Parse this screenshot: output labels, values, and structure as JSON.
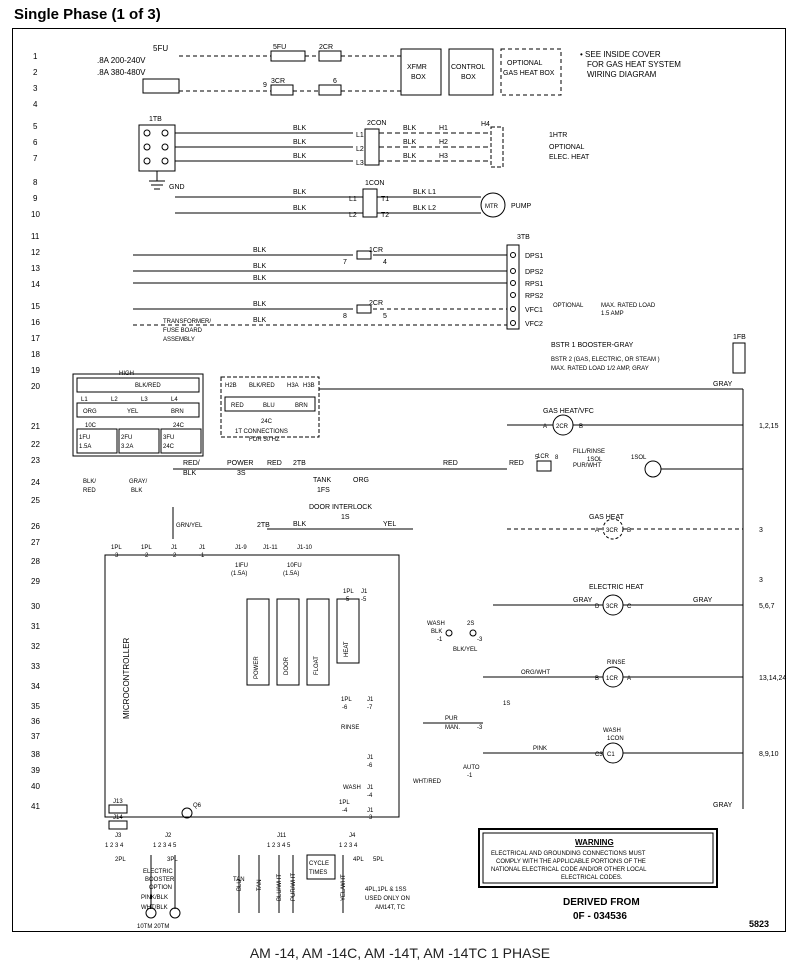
{
  "title": "Single Phase (1 of 3)",
  "caption": "AM -14, AM -14C, AM -14T, AM -14TC 1 PHASE",
  "diagram": {
    "id": "5823",
    "derived_from": "0F - 034536",
    "derived_label": "DERIVED FROM",
    "warning_title": "WARNING",
    "warning_text": "ELECTRICAL AND GROUNDING CONNECTIONS MUST COMPLY WITH THE APPLICABLE PORTIONS OF THE NATIONAL ELECTRICAL CODE AND/OR OTHER LOCAL ELECTRICAL CODES.",
    "note": "SEE INSIDE COVER FOR GAS HEAT SYSTEM WIRING DIAGRAM",
    "row_numbers_left": [
      1,
      2,
      3,
      4,
      5,
      6,
      7,
      8,
      9,
      10,
      11,
      12,
      13,
      14,
      15,
      16,
      17,
      18,
      19,
      20,
      21,
      22,
      23,
      24,
      25,
      26,
      27,
      28,
      29,
      30,
      31,
      32,
      33,
      34,
      35,
      36,
      37,
      38,
      39,
      40,
      41
    ],
    "row_tags_right": {
      "21": "1,2,15",
      "26": "3",
      "29": "3",
      "30": "5,6,7",
      "33": "13,14,24",
      "37": "8,9,10"
    },
    "header": {
      "fu_block": "5FU\n.8A 200-240V\n.8A 380-480V",
      "sec_5fu": "5FU",
      "sec_2cr": "2CR",
      "ref_9": "9",
      "ref_3cr": "3CR",
      "ref_6": "6",
      "xfmr": "XFMR\nBOX",
      "control": "CONTROL\nBOX",
      "optional_gas": "OPTIONAL\nGAS HEAT BOX"
    },
    "tb": {
      "label": "1TB",
      "con2": "2CON",
      "h1": "H1",
      "h2": "H2",
      "h3": "H3",
      "h4": "H4",
      "l1": "L1",
      "l2": "L2",
      "l3": "L3",
      "ihtr": "1HTR",
      "opt_elec": "OPTIONAL\nELEC. HEAT",
      "gnd": "GND",
      "icon": "1CON",
      "t1": "T1",
      "t2": "T2",
      "blk_l1": "BLK  L1",
      "blk_l2": "BLK  L2",
      "mtr": "MTR",
      "pump": "PUMP"
    },
    "icr": {
      "r7": "7",
      "r8_1": "8",
      "r8_2": "8",
      "icr": "1CR",
      "cr2": "2CR",
      "label_3tb": "3TB",
      "dps1": "DPS1",
      "dps2": "DPS2",
      "rps1": "RPS1",
      "rps2": "RPS2",
      "vfc1": "VFC1",
      "vfc2": "VFC2",
      "vfc_note": "OPTIONAL MAX. RATED LOAD\n1.5 AMP",
      "bstr1": "BSTR 1 BOOSTER-GRAY",
      "bstr2": "BSTR 2 (GAS, ELECTRIC, OR STEAM )\nMAX. RATED LOAD 1/2 AMP, GRAY",
      "ifb": "1FB"
    },
    "xfmr_assy": {
      "label": "TRANSFORMER/\nFUSE BOARD\nASSEMBLY",
      "high": "HIGH",
      "blk_red": "BLK/RED",
      "li1": "L1",
      "li2": "L2",
      "li3": "L3",
      "li4": "L4",
      "wireL": "ORG",
      "wireC": "YEL",
      "wireR": "BRN",
      "lowL": "10C",
      "lowR": "24C",
      "fu1": "1FU\n1.5A",
      "fu2": "2FU\n3.2A",
      "fu3": "3FU\n24C",
      "xfmr2": {
        "h2b": "H2B",
        "blkred": "BLK/RED",
        "h3a": "H3A",
        "h3b": "H3B",
        "wireL": "RED",
        "wireC": "BLU",
        "wireR": "BRN",
        "low": "24C",
        "note": "1T CONNECTIONS\nFOR 50 HZ"
      }
    },
    "bus": {
      "red": "RED",
      "gray": "GRAY",
      "blk": "BLK",
      "power3s": "POWER\n3S",
      "red_blk": "RED/\nBLK",
      "blk_red": "BLK/\nRED",
      "gray_blk": "GRAY/\nBLK",
      "grn_yel": "GRN/YEL",
      "org": "ORG",
      "yel": "YEL",
      "pur_wht": "PUR/WHT",
      "pink": "PINK",
      "blu": "BLU",
      "tan": "TAN",
      "wht_red": "WHT/RED",
      "org_wht": "ORG/WHT",
      "blu_wht": "BLU/WHT",
      "pur_wht2": "PUR/WHT",
      "yel_wht": "YEL/WHT",
      "pink_blk": "PINK/BLK",
      "wht_blk": "WHT/BLK"
    },
    "right_components": {
      "gasheat_vfc": "GAS HEAT/VFC",
      "cr2": "2CR",
      "a": "A",
      "b": "B",
      "icr5": "1CR",
      "fillrinse": "FILL/RINSE\n1SOL",
      "isol": "1SOL",
      "five": "5",
      "gasheat": "GAS HEAT",
      "cr3": "3CR",
      "elecheat": "ELECTRIC HEAT",
      "d": "D",
      "c3cr": "3CR",
      "c": "C",
      "rinse": "RINSE",
      "icr_a": "1CR",
      "b2": "B",
      "a2": "A",
      "wash1con": "WASH\n1CON",
      "c3": "C3",
      "c1": "C1"
    },
    "micro": {
      "label": "MICROCONTROLLER",
      "ipl1": "1PL\n-3",
      "ipl2": "1PL\n-2",
      "j1": "J1\n-2",
      "j1_1": "J1\n-1",
      "j1_9": "J1-9",
      "j1_11": "J1-11",
      "j1_10": "J1-10",
      "iifu": "1IFU\n(1.5A)",
      "iofu": "10FU\n(1.5A)",
      "tank_ifs": "TANK\n1FS",
      "door1s": "DOOR INTERLOCK\n1S",
      "s2": "2S",
      "s1": "1S",
      "power": "POWER",
      "door": "DOOR",
      "float": "FLOAT",
      "heat": "HEAT",
      "rinse": "RINSE",
      "wash": "WASH",
      "ipl5": "1PL\n-5",
      "ipl6": "1PL\n-6",
      "ipl4": "1PL\n-4",
      "j1_5": "J1\n-5",
      "j1_6": "J1\n-6",
      "j1_7": "J1\n-7",
      "j1_4": "J1\n-4",
      "j1_3": "J1\n-3",
      "cyc": "CYCLE\nTIMES",
      "j13": "J13",
      "j14": "J14",
      "q6": "Q6",
      "j3": "J3",
      "j2": "J2",
      "j11": "J11",
      "j4": "J4",
      "pins": "1 2 3 4",
      "pins5": "1 2 3 4 5",
      "ipl2b": "2PL",
      "ipl3": "3PL",
      "ipl4b": "4PL",
      "ipl5b": "5PL",
      "elecbooster": "ELECTRIC\nBOOSTER\nOPTION",
      "tm": "10TM 20TM",
      "note_j4": "4PL,1PL & 1SS\nUSED ONLY ON\nAM14T, TC",
      "wash_blk": "WASH\nBLK",
      "blk_yel": "BLK/YEL",
      "wash_note": "WASH\n-1\n-3",
      "pur_note": "PUR\nMAN.",
      "auto": "AUTO",
      "n3": "-3"
    },
    "colors": {
      "blk": "BLK",
      "red": "RED",
      "gray": "GRAY",
      "org": "ORG",
      "yel": "YEL",
      "grn": "GRN",
      "pur": "PUR",
      "pink": "PINK",
      "blu": "BLU",
      "tan": "TAN",
      "brn": "BRN",
      "wht": "WHT"
    }
  }
}
